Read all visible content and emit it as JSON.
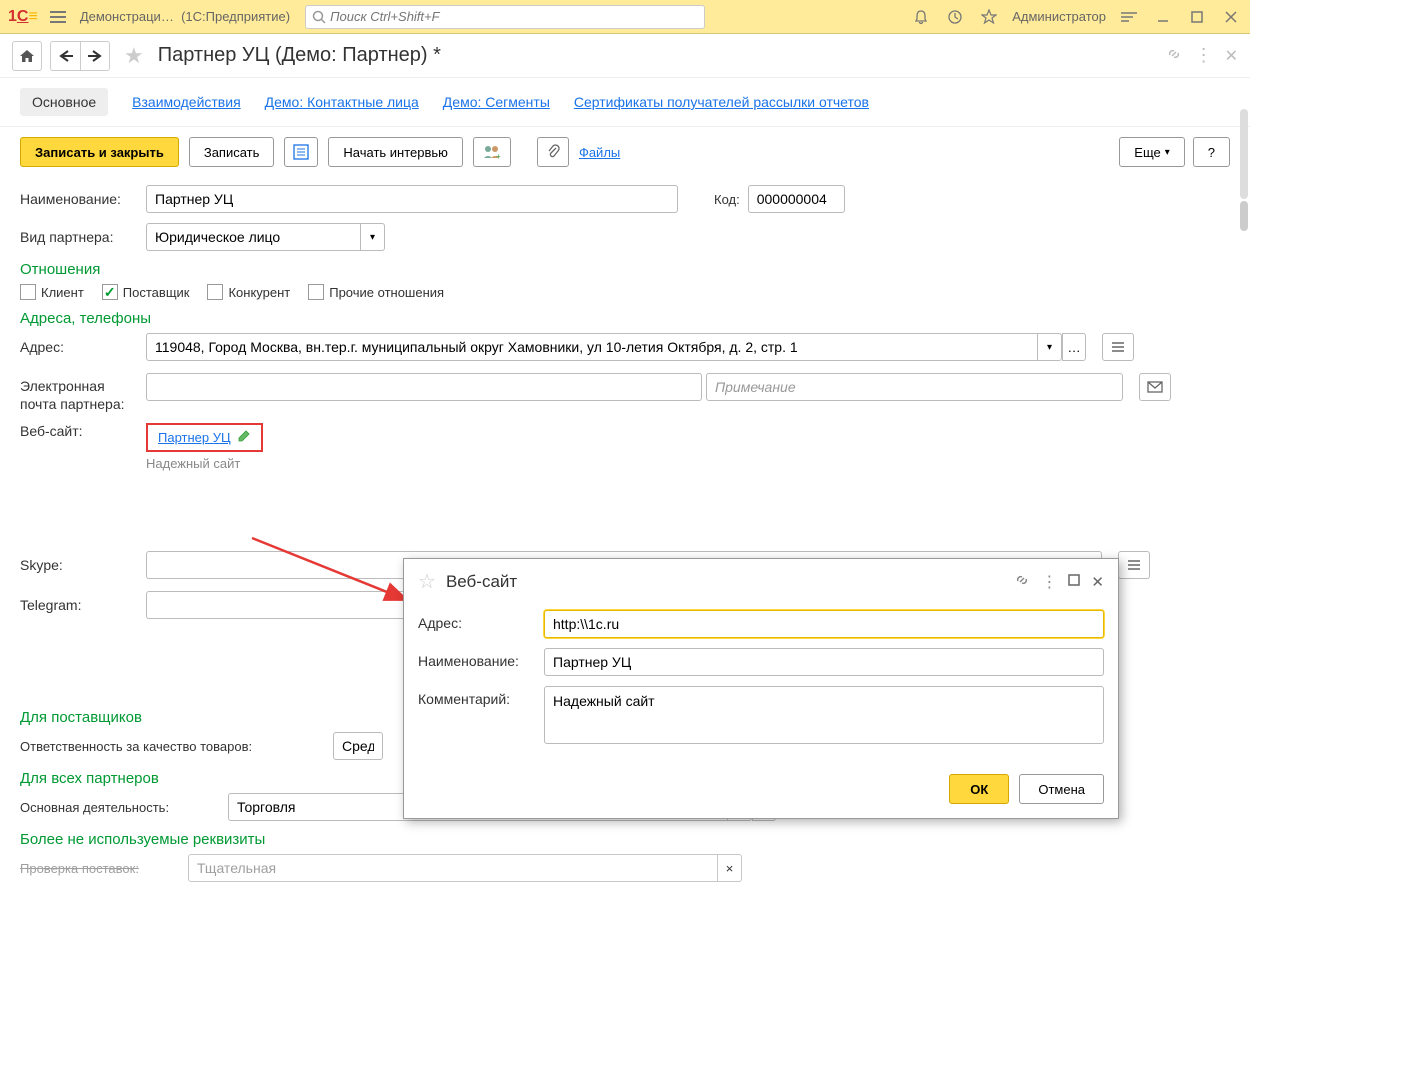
{
  "titlebar": {
    "logo": "1С",
    "app_title": "Демонстраци…",
    "app_subtitle": "(1С:Предприятие)",
    "search_placeholder": "Поиск Ctrl+Shift+F",
    "user": "Администратор"
  },
  "page": {
    "title": "Партнер УЦ (Демо: Партнер) *"
  },
  "tabs": [
    {
      "label": "Основное",
      "active": true
    },
    {
      "label": "Взаимодействия"
    },
    {
      "label": "Демо: Контактные лица"
    },
    {
      "label": "Демо: Сегменты"
    },
    {
      "label": "Сертификаты получателей рассылки отчетов"
    }
  ],
  "cmdbar": {
    "save_close": "Записать и закрыть",
    "save": "Записать",
    "interview": "Начать интервью",
    "files": "Файлы",
    "more": "Еще"
  },
  "form": {
    "name_label": "Наименование:",
    "name_value": "Партнер УЦ",
    "code_label": "Код:",
    "code_value": "000000004",
    "partner_type_label": "Вид партнера:",
    "partner_type_value": "Юридическое лицо",
    "relations_title": "Отношения",
    "chk_client": "Клиент",
    "chk_supplier": "Поставщик",
    "chk_competitor": "Конкурент",
    "chk_other": "Прочие отношения",
    "addresses_title": "Адреса, телефоны",
    "address_label": "Адрес:",
    "address_value": "119048, Город Москва, вн.тер.г. муниципальный округ Хамовники, ул 10-летия Октября, д. 2, стр. 1",
    "email_label": "Электронная почта партнера:",
    "email_note_placeholder": "Примечание",
    "website_label": "Веб-сайт:",
    "website_link": "Партнер УЦ",
    "website_note": "Надежный сайт",
    "skype_label": "Skype:",
    "telegram_label": "Telegram:",
    "suppliers_title": "Для поставщиков",
    "quality_label": "Ответственность за качество товаров:",
    "quality_value": "Средн",
    "all_partners_title": "Для всех партнеров",
    "activity_label": "Основная деятельность:",
    "activity_value": "Торговля",
    "deprecated_title": "Более не используемые реквизиты",
    "check_label": "Проверка поставок:",
    "check_value": "Тщательная"
  },
  "dialog": {
    "title": "Веб-сайт",
    "address_label": "Адрес:",
    "address_value": "http:\\\\1c.ru",
    "name_label": "Наименование:",
    "name_value": "Партнер УЦ",
    "comment_label": "Комментарий:",
    "comment_value": "Надежный сайт",
    "ok": "ОК",
    "cancel": "Отмена"
  }
}
